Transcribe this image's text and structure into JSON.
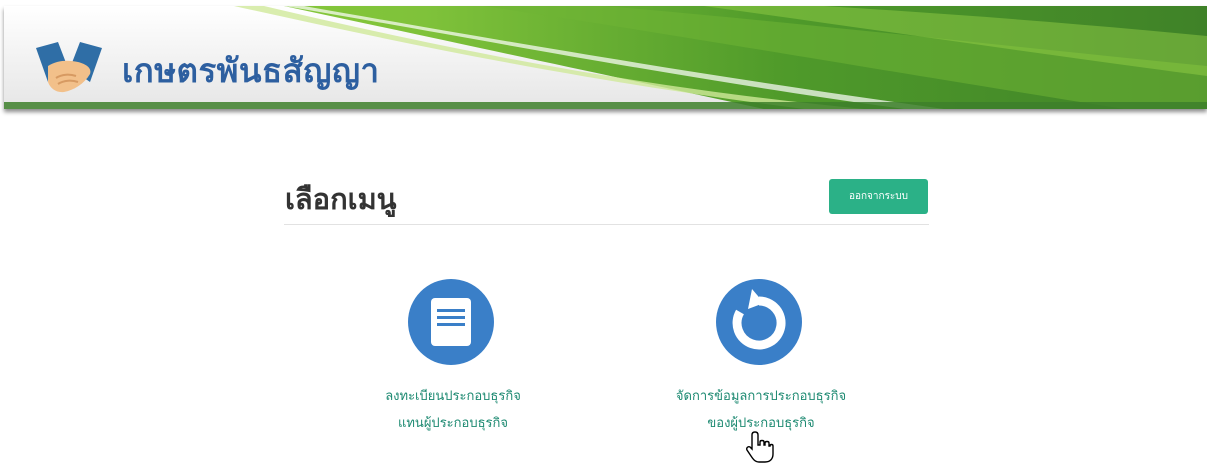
{
  "header": {
    "app_title": "เกษตรพันธสัญญา"
  },
  "main": {
    "title": "เลือกเมนู",
    "logout_label": "ออกจากระบบ",
    "menu_items": [
      {
        "line1": "ลงทะเบียนประกอบธุรกิจ",
        "line2": "แทนผู้ประกอบธุรกิจ",
        "icon": "document-icon"
      },
      {
        "line1": "จัดการข้อมูลการประกอบธุรกิจ",
        "line2": "ของผู้ประกอบธุรกิจ",
        "icon": "refresh-icon"
      }
    ]
  },
  "colors": {
    "accent": "#2bb187",
    "icon_circle": "#3a7fc8",
    "menu_text": "#1e8a72",
    "title_blue": "#2d5fa0",
    "banner_green": "#4f9a2a"
  }
}
